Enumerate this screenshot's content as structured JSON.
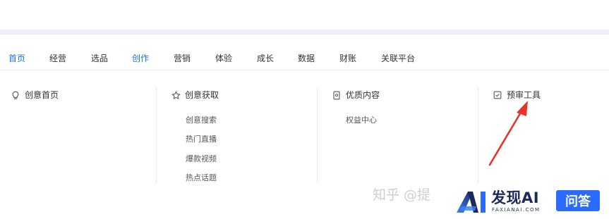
{
  "nav": {
    "tabs": [
      {
        "label": "首页",
        "active": true
      },
      {
        "label": "经营",
        "active": false
      },
      {
        "label": "选品",
        "active": false
      },
      {
        "label": "创作",
        "active": true
      },
      {
        "label": "营销",
        "active": false
      },
      {
        "label": "体验",
        "active": false
      },
      {
        "label": "成长",
        "active": false
      },
      {
        "label": "数据",
        "active": false
      },
      {
        "label": "财账",
        "active": false
      },
      {
        "label": "关联平台",
        "active": false
      }
    ]
  },
  "menu": {
    "columns": [
      {
        "title": "创意首页",
        "icon": "lightbulb-icon",
        "items": []
      },
      {
        "title": "创意获取",
        "icon": "star-icon",
        "items": [
          "创意搜索",
          "热门直播",
          "爆款视频",
          "热点话题"
        ]
      },
      {
        "title": "优质内容",
        "icon": "document-icon",
        "items": [
          "权益中心"
        ]
      },
      {
        "title": "预审工具",
        "icon": "checkbox-icon",
        "items": []
      }
    ]
  },
  "annotation": {
    "arrow_color": "#e8332a"
  },
  "watermark": {
    "text": "知乎 @提"
  },
  "brand": {
    "name": "发现AI",
    "sub": "FAXIANAI.COM",
    "badge": "问答"
  },
  "colors": {
    "accent": "#1e72e8",
    "brand_navy": "#1b2b59",
    "brand_blue": "#2a6cff"
  }
}
